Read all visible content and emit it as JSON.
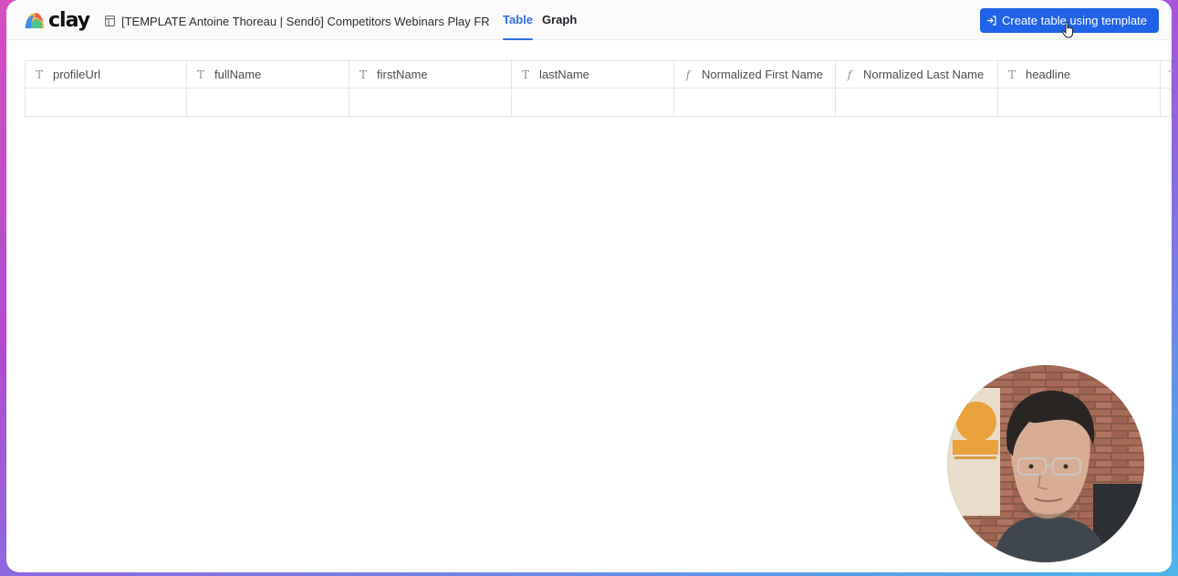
{
  "app": {
    "brand": "clay",
    "document_title": "[TEMPLATE Antoine Thoreau | Sendō] Competitors Webinars Play FR"
  },
  "tabs": [
    {
      "label": "Table",
      "active": true
    },
    {
      "label": "Graph",
      "active": false
    }
  ],
  "actions": {
    "create_label": "Create table using template"
  },
  "table": {
    "columns": [
      {
        "name": "profileUrl",
        "type": "text",
        "type_glyph": "T"
      },
      {
        "name": "fullName",
        "type": "text",
        "type_glyph": "T"
      },
      {
        "name": "firstName",
        "type": "text",
        "type_glyph": "T"
      },
      {
        "name": "lastName",
        "type": "text",
        "type_glyph": "T"
      },
      {
        "name": "Normalized First Name",
        "type": "formula",
        "type_glyph": "f"
      },
      {
        "name": "Normalized Last Name",
        "type": "formula",
        "type_glyph": "f"
      },
      {
        "name": "headline",
        "type": "text",
        "type_glyph": "T"
      },
      {
        "name": "",
        "type": "text",
        "type_glyph": "T"
      }
    ]
  },
  "colors": {
    "accent": "#2163e8",
    "tab_active": "#2f6fe6",
    "grid_line": "#e3e5e9"
  }
}
